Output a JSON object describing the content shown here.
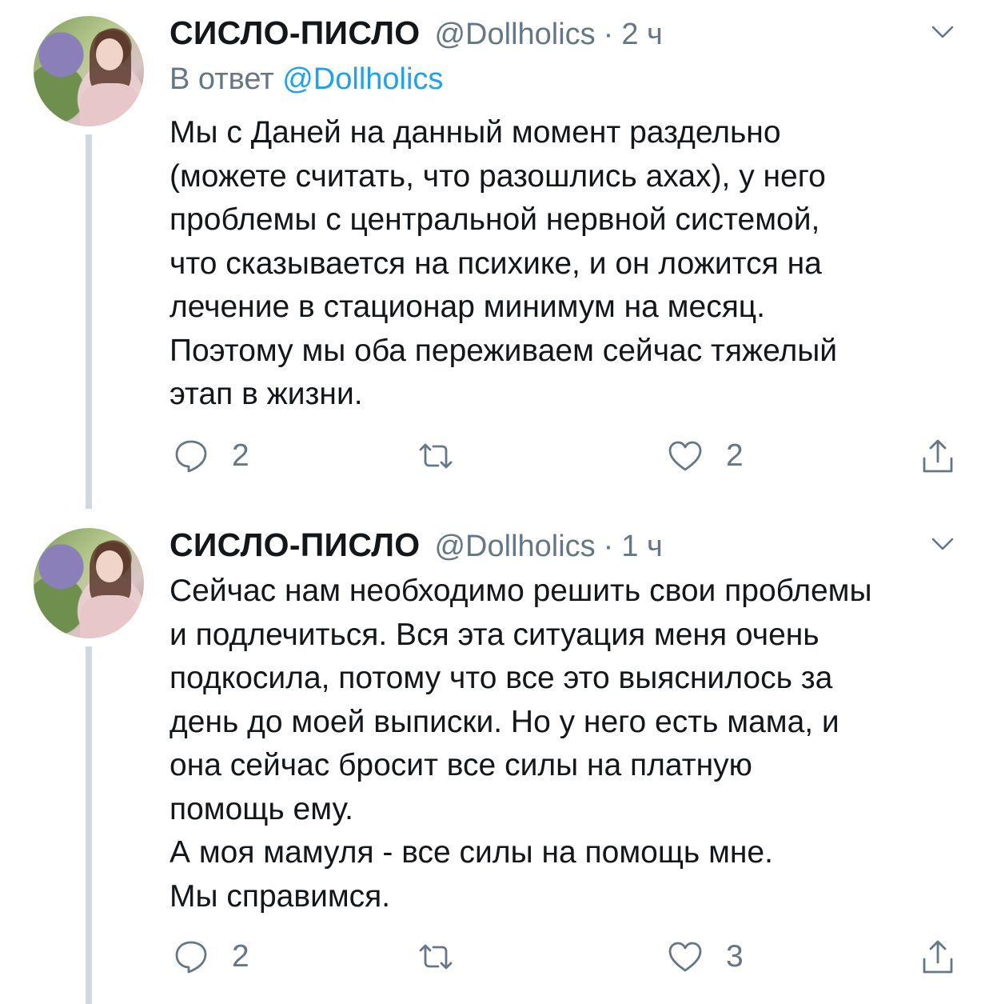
{
  "tweets": [
    {
      "author_name": "СИСЛО-ПИСЛО",
      "handle": "@Dollholics",
      "separator": "·",
      "time": "2 ч",
      "reply_prefix": "В ответ",
      "reply_mention": "@Dollholics",
      "text": "Мы с Даней на данный момент раздельно\n(можете считать, что разошлись ахах),  у него\nпроблемы с центральной нервной системой,\nчто сказывается на психике, и он ложится на\nлечение в стационар минимум на месяц.\nПоэтому мы оба переживаем сейчас тяжелый\nэтап в жизни.",
      "reply_count": "2",
      "like_count": "2"
    },
    {
      "author_name": "СИСЛО-ПИСЛО",
      "handle": "@Dollholics",
      "separator": "·",
      "time": "1 ч",
      "text": "Сейчас нам необходимо решить свои проблемы\nи подлечиться. Вся эта ситуация меня очень\nподкосила, потому что все это выяснилось за\nдень до моей выписки. Но у него есть мама, и\nона сейчас бросит все силы на платную\nпомощь ему.\nА моя мамуля - все силы на помощь мне.\nМы справимся.",
      "reply_count": "2",
      "like_count": "3"
    }
  ],
  "icons": {
    "reply": "reply-icon",
    "retweet": "retweet-icon",
    "like": "heart-icon",
    "share": "share-icon",
    "menu": "chevron-down-icon"
  },
  "colors": {
    "text": "#14171a",
    "secondary": "#657786",
    "link": "#1da1f2",
    "thread_line": "#cfd9de"
  }
}
